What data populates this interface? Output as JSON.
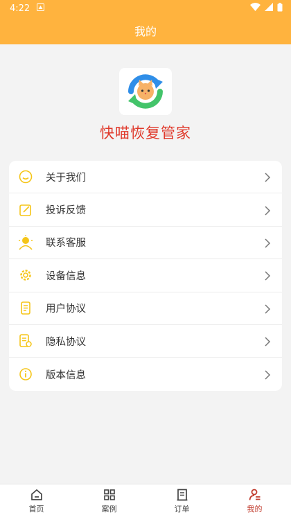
{
  "status": {
    "time": "4:22"
  },
  "header": {
    "title": "我的"
  },
  "app": {
    "name": "快喵恢复管家"
  },
  "menu": [
    {
      "label": "关于我们",
      "icon": "smile-icon"
    },
    {
      "label": "投诉反馈",
      "icon": "edit-icon"
    },
    {
      "label": "联系客服",
      "icon": "customer-service-icon"
    },
    {
      "label": "设备信息",
      "icon": "gear-icon"
    },
    {
      "label": "用户协议",
      "icon": "document-icon"
    },
    {
      "label": "隐私协议",
      "icon": "privacy-document-icon"
    },
    {
      "label": "版本信息",
      "icon": "info-icon"
    }
  ],
  "tabs": [
    {
      "label": "首页",
      "icon": "home-icon"
    },
    {
      "label": "案例",
      "icon": "grid-icon"
    },
    {
      "label": "订单",
      "icon": "order-icon"
    },
    {
      "label": "我的",
      "icon": "user-icon",
      "active": true
    }
  ],
  "colors": {
    "accent": "#ffb33e",
    "brand_red": "#e0392b",
    "icon_yellow": "#f5c518",
    "active_tab": "#c0392b"
  }
}
